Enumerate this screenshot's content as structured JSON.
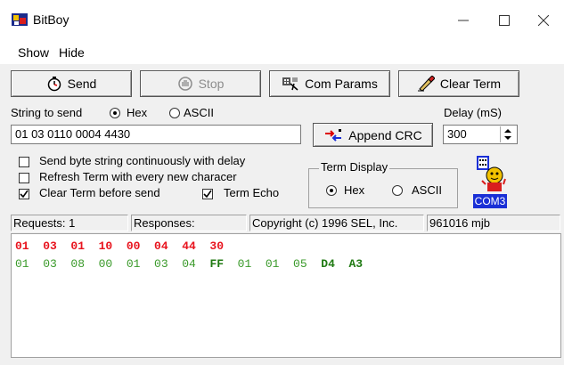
{
  "window": {
    "title": "BitBoy"
  },
  "menu": [
    "Show",
    "Hide"
  ],
  "toolbar": {
    "send_label": "Send",
    "stop_label": "Stop",
    "com_params_label": "Com Params",
    "clear_term_label": "Clear Term"
  },
  "send_form": {
    "string_label": "String to send",
    "hex_label": "Hex",
    "ascii_label": "ASCII",
    "mode_selected": "Hex",
    "value": "01 03 0110 0004 4430",
    "append_crc_label": "Append CRC",
    "delay_label": "Delay (mS)",
    "delay_value": "300"
  },
  "options": {
    "continuous_label": "Send byte string continuously with delay",
    "continuous_checked": false,
    "refresh_label": "Refresh Term with every new characer",
    "refresh_checked": false,
    "clear_before_label": "Clear Term before send",
    "clear_before_checked": true,
    "term_echo_label": "Term Echo",
    "term_echo_checked": true
  },
  "term_display": {
    "group_label": "Term Display",
    "hex_label": "Hex",
    "ascii_label": "ASCII",
    "selected": "Hex"
  },
  "com_badge": {
    "label": "COM3"
  },
  "status": {
    "requests": "Requests: 1",
    "responses": "Responses:",
    "copyright": "Copyright (c) 1996 SEL, Inc.",
    "version": "961016 mjb"
  },
  "terminal": {
    "sent_line": "01  03  01  10  00  04  44  30",
    "resp_a": "01  03  08  00  01  03  04  ",
    "resp_b": "FF",
    "resp_c": "  01  01  05  ",
    "resp_d": "D4  A3"
  },
  "colors": {
    "sent": "#e8141e",
    "response": "#3a9a2a",
    "response_bold": "#1f7a12",
    "com_badge": "#1a2fd6"
  }
}
